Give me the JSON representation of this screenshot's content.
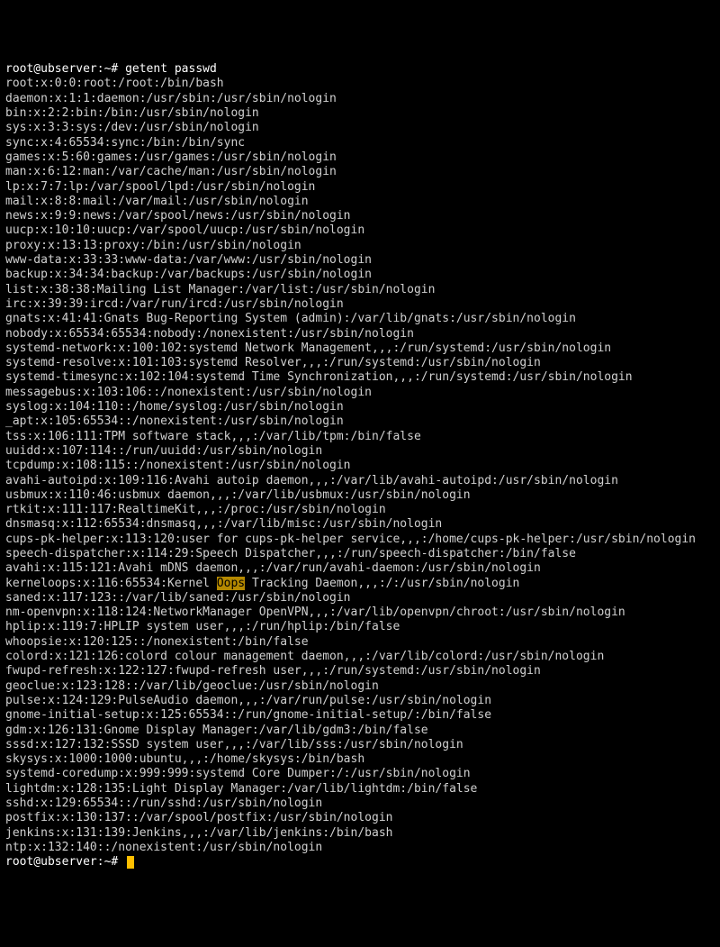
{
  "prompt": {
    "user_host": "root@ubserver",
    "path": "~",
    "symbol": "#"
  },
  "command": "getent passwd",
  "highlight_word": "Oops",
  "output_lines": [
    "root:x:0:0:root:/root:/bin/bash",
    "daemon:x:1:1:daemon:/usr/sbin:/usr/sbin/nologin",
    "bin:x:2:2:bin:/bin:/usr/sbin/nologin",
    "sys:x:3:3:sys:/dev:/usr/sbin/nologin",
    "sync:x:4:65534:sync:/bin:/bin/sync",
    "games:x:5:60:games:/usr/games:/usr/sbin/nologin",
    "man:x:6:12:man:/var/cache/man:/usr/sbin/nologin",
    "lp:x:7:7:lp:/var/spool/lpd:/usr/sbin/nologin",
    "mail:x:8:8:mail:/var/mail:/usr/sbin/nologin",
    "news:x:9:9:news:/var/spool/news:/usr/sbin/nologin",
    "uucp:x:10:10:uucp:/var/spool/uucp:/usr/sbin/nologin",
    "proxy:x:13:13:proxy:/bin:/usr/sbin/nologin",
    "www-data:x:33:33:www-data:/var/www:/usr/sbin/nologin",
    "backup:x:34:34:backup:/var/backups:/usr/sbin/nologin",
    "list:x:38:38:Mailing List Manager:/var/list:/usr/sbin/nologin",
    "irc:x:39:39:ircd:/var/run/ircd:/usr/sbin/nologin",
    "gnats:x:41:41:Gnats Bug-Reporting System (admin):/var/lib/gnats:/usr/sbin/nologin",
    "nobody:x:65534:65534:nobody:/nonexistent:/usr/sbin/nologin",
    "systemd-network:x:100:102:systemd Network Management,,,:/run/systemd:/usr/sbin/nologin",
    "systemd-resolve:x:101:103:systemd Resolver,,,:/run/systemd:/usr/sbin/nologin",
    "systemd-timesync:x:102:104:systemd Time Synchronization,,,:/run/systemd:/usr/sbin/nologin",
    "messagebus:x:103:106::/nonexistent:/usr/sbin/nologin",
    "syslog:x:104:110::/home/syslog:/usr/sbin/nologin",
    "_apt:x:105:65534::/nonexistent:/usr/sbin/nologin",
    "tss:x:106:111:TPM software stack,,,:/var/lib/tpm:/bin/false",
    "uuidd:x:107:114::/run/uuidd:/usr/sbin/nologin",
    "tcpdump:x:108:115::/nonexistent:/usr/sbin/nologin",
    "avahi-autoipd:x:109:116:Avahi autoip daemon,,,:/var/lib/avahi-autoipd:/usr/sbin/nologin",
    "usbmux:x:110:46:usbmux daemon,,,:/var/lib/usbmux:/usr/sbin/nologin",
    "rtkit:x:111:117:RealtimeKit,,,:/proc:/usr/sbin/nologin",
    "dnsmasq:x:112:65534:dnsmasq,,,:/var/lib/misc:/usr/sbin/nologin",
    "cups-pk-helper:x:113:120:user for cups-pk-helper service,,,:/home/cups-pk-helper:/usr/sbin/nologin",
    "speech-dispatcher:x:114:29:Speech Dispatcher,,,:/run/speech-dispatcher:/bin/false",
    "avahi:x:115:121:Avahi mDNS daemon,,,:/var/run/avahi-daemon:/usr/sbin/nologin",
    "kerneloops:x:116:65534:Kernel Oops Tracking Daemon,,,:/:/usr/sbin/nologin",
    "saned:x:117:123::/var/lib/saned:/usr/sbin/nologin",
    "nm-openvpn:x:118:124:NetworkManager OpenVPN,,,:/var/lib/openvpn/chroot:/usr/sbin/nologin",
    "hplip:x:119:7:HPLIP system user,,,:/run/hplip:/bin/false",
    "whoopsie:x:120:125::/nonexistent:/bin/false",
    "colord:x:121:126:colord colour management daemon,,,:/var/lib/colord:/usr/sbin/nologin",
    "fwupd-refresh:x:122:127:fwupd-refresh user,,,:/run/systemd:/usr/sbin/nologin",
    "geoclue:x:123:128::/var/lib/geoclue:/usr/sbin/nologin",
    "pulse:x:124:129:PulseAudio daemon,,,:/var/run/pulse:/usr/sbin/nologin",
    "gnome-initial-setup:x:125:65534::/run/gnome-initial-setup/:/bin/false",
    "gdm:x:126:131:Gnome Display Manager:/var/lib/gdm3:/bin/false",
    "sssd:x:127:132:SSSD system user,,,:/var/lib/sss:/usr/sbin/nologin",
    "skysys:x:1000:1000:ubuntu,,,:/home/skysys:/bin/bash",
    "systemd-coredump:x:999:999:systemd Core Dumper:/:/usr/sbin/nologin",
    "lightdm:x:128:135:Light Display Manager:/var/lib/lightdm:/bin/false",
    "sshd:x:129:65534::/run/sshd:/usr/sbin/nologin",
    "postfix:x:130:137::/var/spool/postfix:/usr/sbin/nologin",
    "jenkins:x:131:139:Jenkins,,,:/var/lib/jenkins:/bin/bash",
    "ntp:x:132:140::/nonexistent:/usr/sbin/nologin"
  ]
}
